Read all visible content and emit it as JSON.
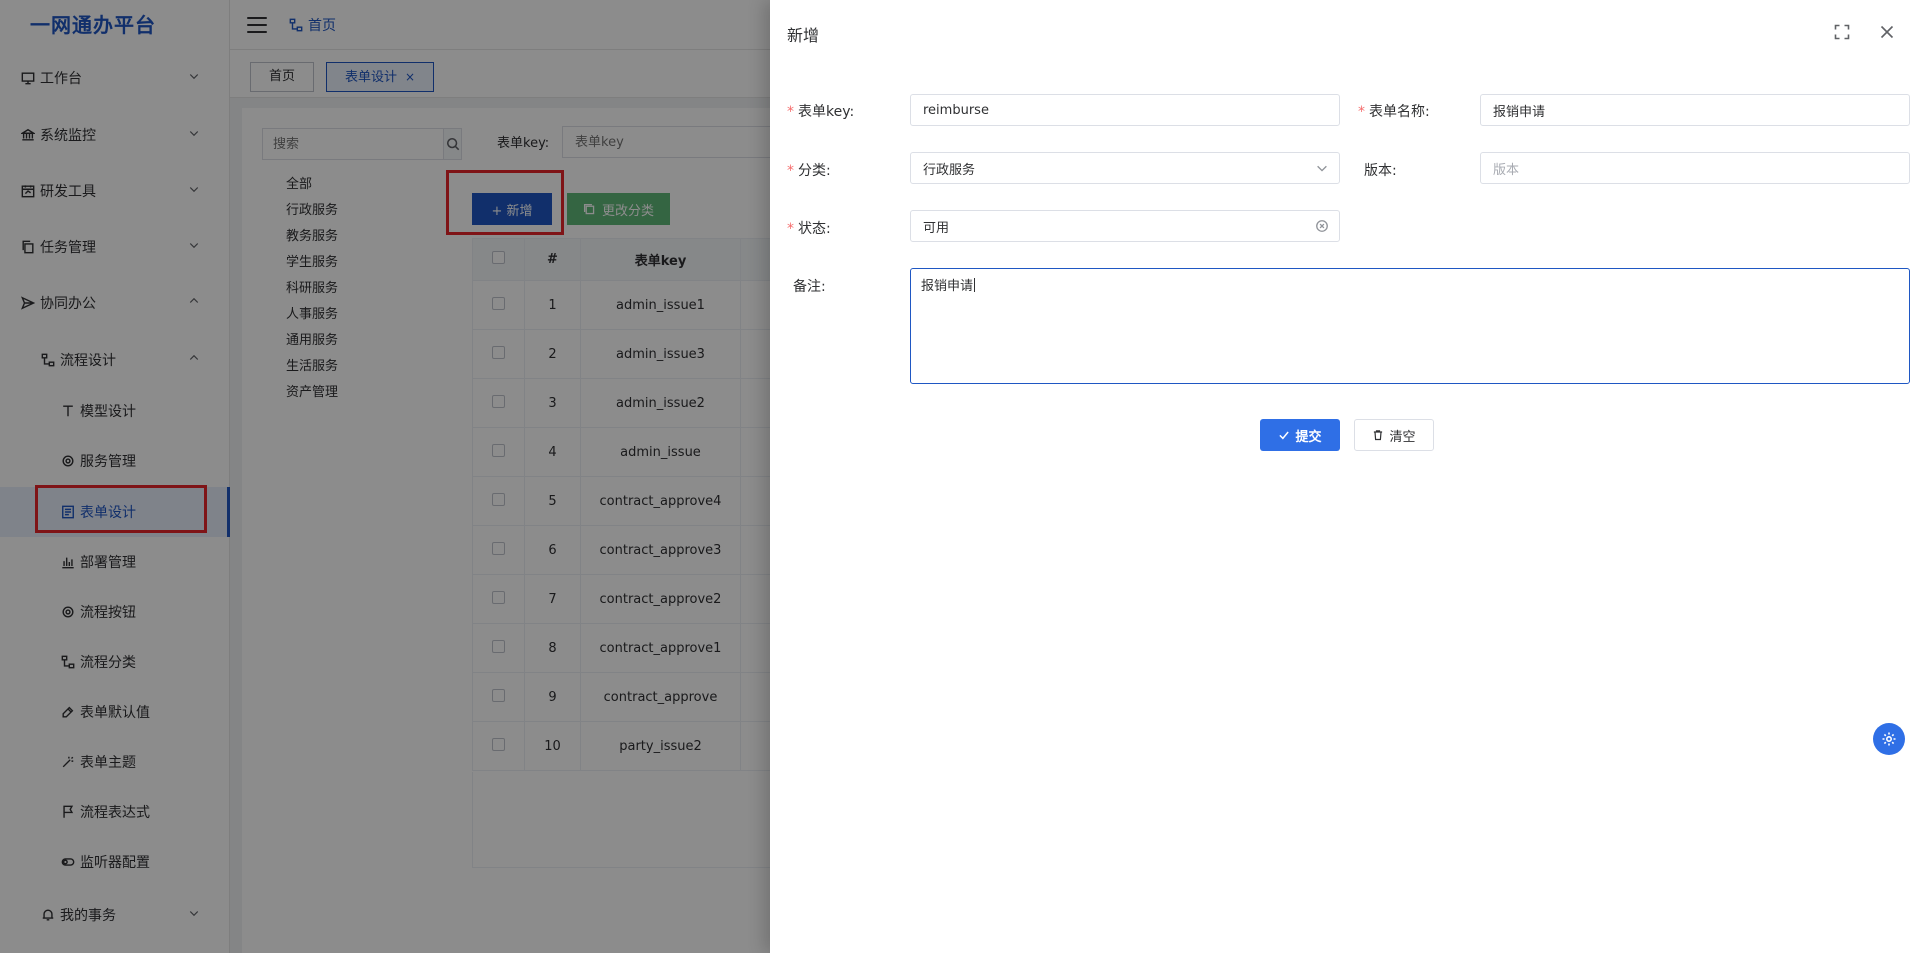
{
  "app": {
    "brand": "一网通办平台"
  },
  "header": {
    "breadcrumb": "首页"
  },
  "tabs": [
    {
      "label": "首页"
    },
    {
      "label": "表单设计",
      "close": "×"
    }
  ],
  "sidebar": {
    "items": [
      {
        "label": "工作台",
        "icon": "monitor-icon"
      },
      {
        "label": "系统监控",
        "icon": "bank-icon"
      },
      {
        "label": "研发工具",
        "icon": "calendar-icon"
      },
      {
        "label": "任务管理",
        "icon": "copy-icon"
      },
      {
        "label": "协同办公",
        "icon": "send-icon"
      },
      {
        "label": "流程设计",
        "icon": "flow-icon"
      },
      {
        "label": "模型设计",
        "icon": "type-icon"
      },
      {
        "label": "服务管理",
        "icon": "gear-icon"
      },
      {
        "label": "表单设计",
        "icon": "form-icon"
      },
      {
        "label": "部署管理",
        "icon": "bar-chart-icon"
      },
      {
        "label": "流程按钮",
        "icon": "gear-icon"
      },
      {
        "label": "流程分类",
        "icon": "flow-icon"
      },
      {
        "label": "表单默认值",
        "icon": "link-icon"
      },
      {
        "label": "表单主题",
        "icon": "magic-icon"
      },
      {
        "label": "流程表达式",
        "icon": "flag-icon"
      },
      {
        "label": "监听器配置",
        "icon": "toggle-icon"
      },
      {
        "label": "我的事务",
        "icon": "bell-icon"
      }
    ]
  },
  "main": {
    "search_placeholder": "搜索",
    "categories": [
      "全部",
      "行政服务",
      "教务服务",
      "学生服务",
      "科研服务",
      "人事服务",
      "通用服务",
      "生活服务",
      "资产管理"
    ],
    "filter_label": "表单key:",
    "filter_placeholder": "表单key",
    "add_button": "+ 新增",
    "change_category_button": "更改分类",
    "table": {
      "headers": [
        "#",
        "表单key"
      ],
      "rows": [
        {
          "no": "1",
          "key": "admin_issue1"
        },
        {
          "no": "2",
          "key": "admin_issue3"
        },
        {
          "no": "3",
          "key": "admin_issue2"
        },
        {
          "no": "4",
          "key": "admin_issue"
        },
        {
          "no": "5",
          "key": "contract_approve4"
        },
        {
          "no": "6",
          "key": "contract_approve3"
        },
        {
          "no": "7",
          "key": "contract_approve2"
        },
        {
          "no": "8",
          "key": "contract_approve1"
        },
        {
          "no": "9",
          "key": "contract_approve"
        },
        {
          "no": "10",
          "key": "party_issue2"
        }
      ]
    }
  },
  "drawer": {
    "title": "新增",
    "fields": {
      "form_key": {
        "label": "表单key:",
        "value": "reimburse",
        "required": "*"
      },
      "form_name": {
        "label": "表单名称:",
        "value": "报销申请",
        "required": "*"
      },
      "category": {
        "label": "分类:",
        "value": "行政服务",
        "required": "*"
      },
      "version": {
        "label": "版本:",
        "placeholder": "版本"
      },
      "status": {
        "label": "状态:",
        "value": "可用",
        "required": "*"
      },
      "remark": {
        "label": "备注:",
        "value": "报销申请"
      }
    },
    "submit": "提交",
    "clear": "清空"
  },
  "colors": {
    "primary": "#1f57c3",
    "button_blue": "#2f6fe6",
    "success": "#5fb878",
    "highlight_box": "#e8252b"
  }
}
